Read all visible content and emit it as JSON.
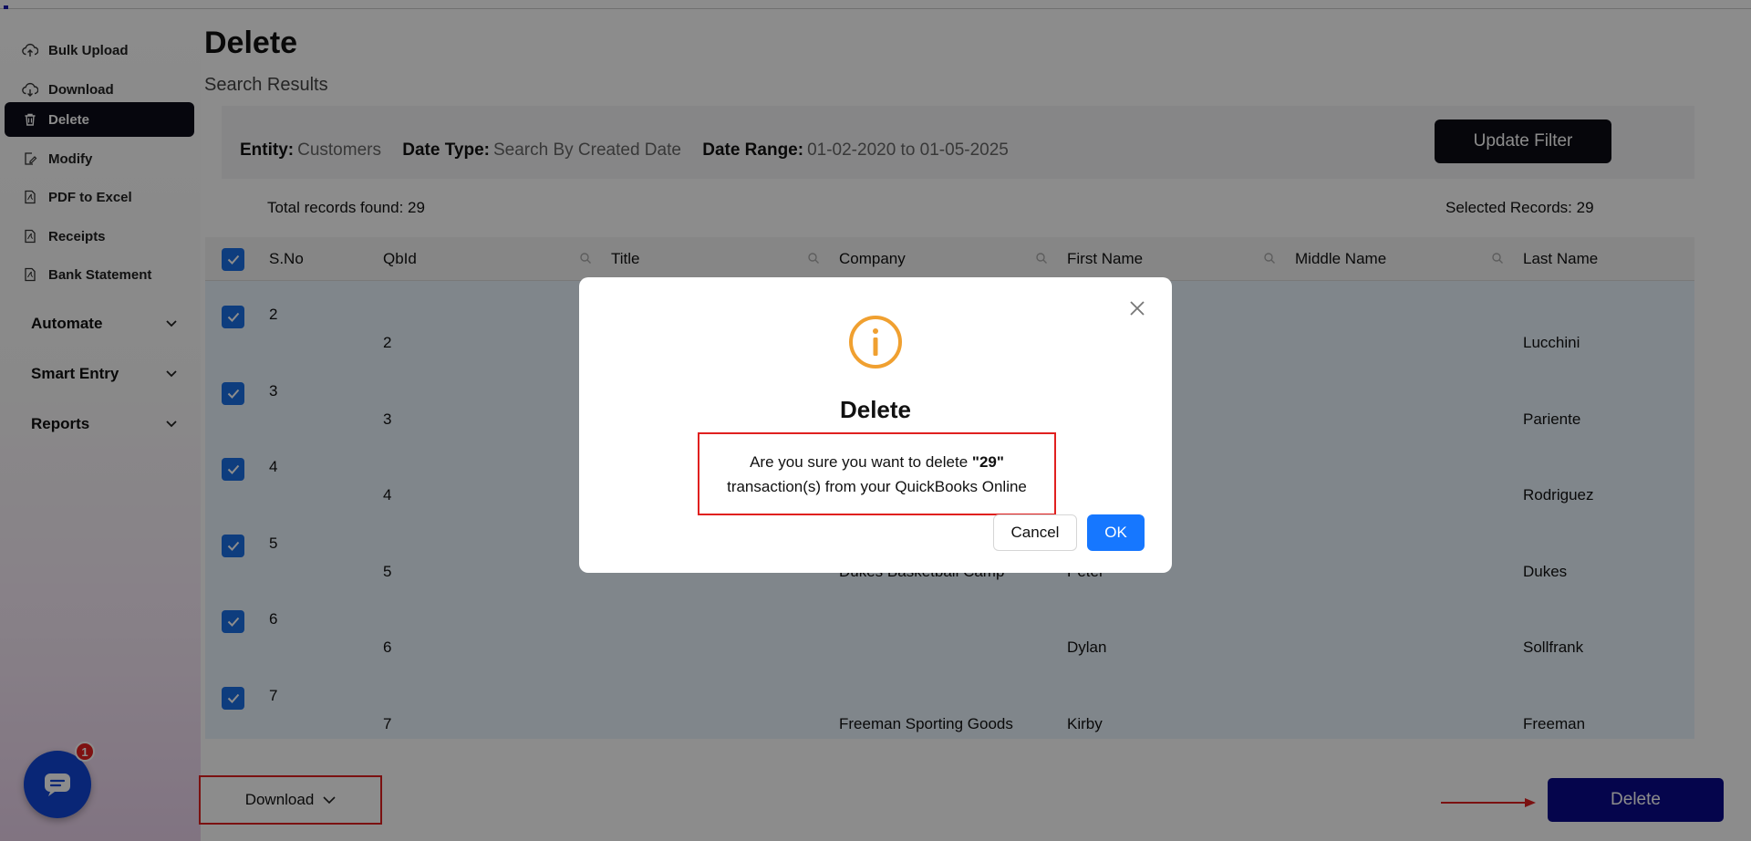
{
  "sidebar": {
    "items": [
      {
        "label": "Bulk Upload",
        "icon": "cloud-upload-icon"
      },
      {
        "label": "Download",
        "icon": "cloud-download-icon"
      },
      {
        "label": "Delete",
        "icon": "trash-icon",
        "active": true
      },
      {
        "label": "Modify",
        "icon": "edit-file-icon"
      },
      {
        "label": "PDF to Excel",
        "icon": "pdf-icon"
      },
      {
        "label": "Receipts",
        "icon": "receipt-icon"
      },
      {
        "label": "Bank Statement",
        "icon": "document-icon"
      }
    ],
    "groups": [
      {
        "label": "Automate"
      },
      {
        "label": "Smart Entry"
      },
      {
        "label": "Reports"
      }
    ]
  },
  "page": {
    "title": "Delete",
    "subtitle": "Search Results"
  },
  "filter": {
    "entity_label": "Entity:",
    "entity_value": "Customers",
    "date_type_label": "Date Type:",
    "date_type_value": "Search By Created Date",
    "date_range_label": "Date Range:",
    "date_range_value": "01-02-2020 to 01-05-2025",
    "update_button": "Update Filter"
  },
  "summary": {
    "total": "Total records found: 29",
    "selected": "Selected Records: 29"
  },
  "table": {
    "columns": [
      "S.No",
      "QbId",
      "Title",
      "Company",
      "First Name",
      "Middle Name",
      "Last Name"
    ],
    "rows": [
      {
        "sno": "2",
        "qbid": "2",
        "title": "",
        "company": "",
        "first": "",
        "middle": "",
        "last": "Lucchini"
      },
      {
        "sno": "3",
        "qbid": "3",
        "title": "",
        "company": "",
        "first": "",
        "middle": "",
        "last": "Pariente"
      },
      {
        "sno": "4",
        "qbid": "4",
        "title": "",
        "company": "",
        "first": "",
        "middle": "",
        "last": "Rodriguez"
      },
      {
        "sno": "5",
        "qbid": "5",
        "title": "",
        "company": "Dukes Basketball Camp",
        "first": "Peter",
        "middle": "",
        "last": "Dukes"
      },
      {
        "sno": "6",
        "qbid": "6",
        "title": "",
        "company": "",
        "first": "Dylan",
        "middle": "",
        "last": "Sollfrank"
      },
      {
        "sno": "7",
        "qbid": "7",
        "title": "",
        "company": "Freeman Sporting Goods",
        "first": "Kirby",
        "middle": "",
        "last": "Freeman"
      }
    ]
  },
  "bottom": {
    "download_label": "Download",
    "delete_label": "Delete"
  },
  "chat": {
    "badge": "1"
  },
  "modal": {
    "title": "Delete",
    "msg_prefix": "Are you sure you want to delete ",
    "msg_count": "\"29\"",
    "msg_line2": "transaction(s) from your QuickBooks Online",
    "cancel": "Cancel",
    "ok": "OK"
  },
  "colors": {
    "accent": "#1677ff",
    "warning": "#f0a030",
    "delete": "#0a0a8a",
    "highlight": "#e0201f"
  }
}
